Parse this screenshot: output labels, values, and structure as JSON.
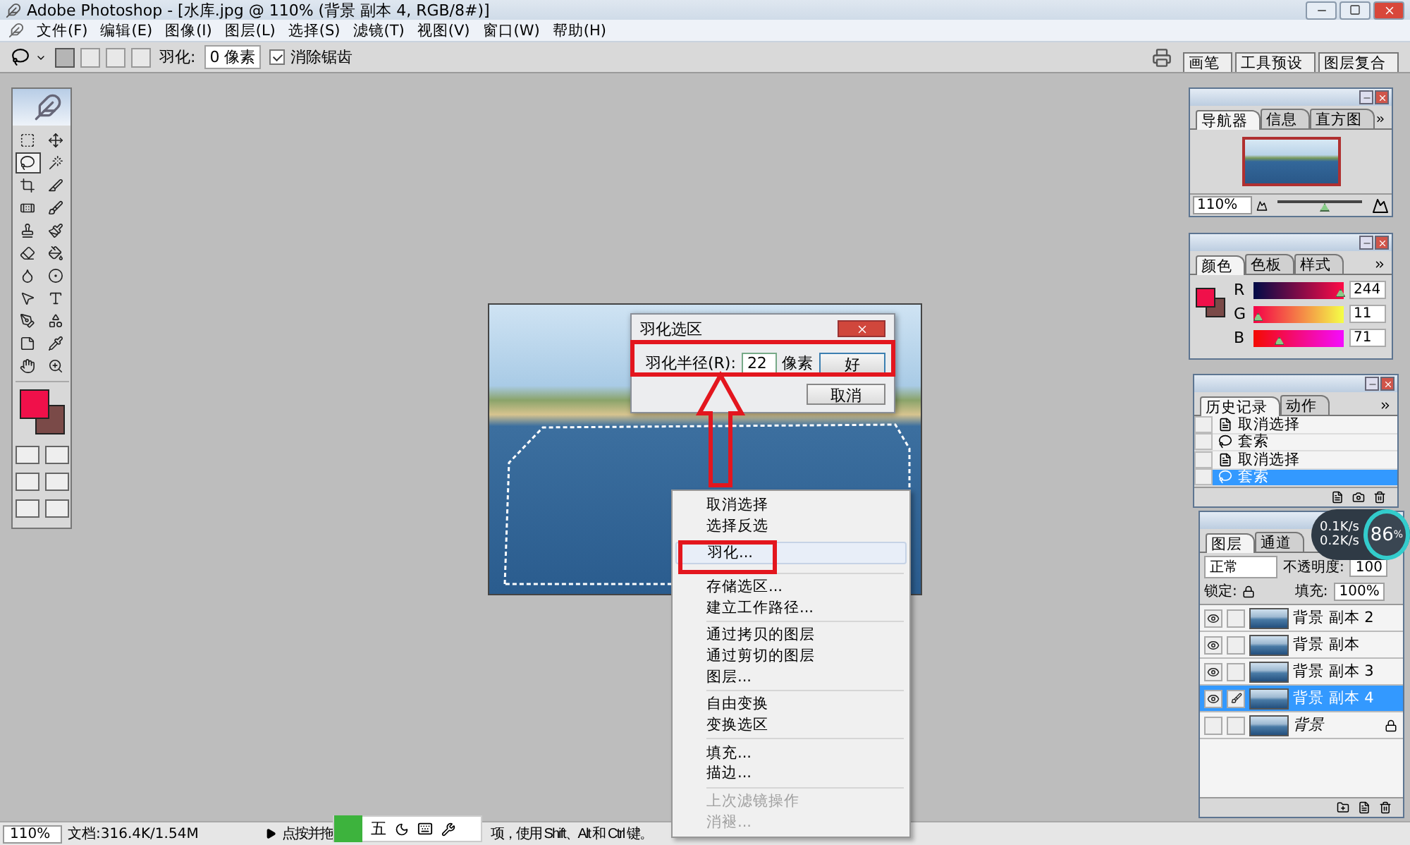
{
  "window": {
    "title": "Adobe Photoshop - [水库.jpg @ 110% (背景 副本 4, RGB/8#)]"
  },
  "menu": [
    "文件(F)",
    "编辑(E)",
    "图像(I)",
    "图层(L)",
    "选择(S)",
    "滤镜(T)",
    "视图(V)",
    "窗口(W)",
    "帮助(H)"
  ],
  "options_bar": {
    "modes": [
      {
        "selected": true
      },
      {
        "selected": false
      },
      {
        "selected": false
      },
      {
        "selected": false
      }
    ],
    "feather_label": "羽化:",
    "feather_value": "0 像素",
    "antialias": {
      "label": "消除锯齿",
      "checked": true
    },
    "palette_well": [
      "画笔",
      "工具预设",
      "图层复合"
    ]
  },
  "toolbox": {
    "tools": [
      {
        "kind": "marquee",
        "selected": false
      },
      {
        "kind": "move",
        "selected": false
      },
      {
        "kind": "lasso",
        "selected": true
      },
      {
        "kind": "wand",
        "selected": false
      },
      {
        "kind": "crop",
        "selected": false
      },
      {
        "kind": "slice",
        "selected": false
      },
      {
        "kind": "healing",
        "selected": false
      },
      {
        "kind": "brush",
        "selected": false
      },
      {
        "kind": "stamp",
        "selected": false
      },
      {
        "kind": "history",
        "selected": false
      },
      {
        "kind": "eraser",
        "selected": false
      },
      {
        "kind": "bucket",
        "selected": false
      },
      {
        "kind": "blur",
        "selected": false
      },
      {
        "kind": "dodge",
        "selected": false
      },
      {
        "kind": "pointer",
        "selected": false
      },
      {
        "kind": "type",
        "selected": false
      },
      {
        "kind": "pen",
        "selected": false
      },
      {
        "kind": "shape",
        "selected": false
      },
      {
        "kind": "notes",
        "selected": false
      },
      {
        "kind": "eyedropper",
        "selected": false
      },
      {
        "kind": "hand",
        "selected": false
      },
      {
        "kind": "zoom",
        "selected": false
      }
    ],
    "swatches": [
      {
        "kind": "foreground",
        "color": "#f0104a"
      },
      {
        "kind": "background",
        "color": "#7a4a48"
      }
    ]
  },
  "navigator": {
    "tabs": [
      {
        "label": "导航器",
        "selected": true
      },
      {
        "label": "信息",
        "selected": false
      },
      {
        "label": "直方图",
        "selected": false
      }
    ],
    "zoom": "110%",
    "slider": {
      "level": 0.55
    }
  },
  "color": {
    "tabs": [
      {
        "label": "颜色",
        "selected": true
      },
      {
        "label": "色板",
        "selected": false
      },
      {
        "label": "样式",
        "selected": false
      }
    ],
    "channels": [
      {
        "name": "R",
        "value": "244",
        "level": 0.957
      },
      {
        "name": "G",
        "value": "11",
        "level": 0.043
      },
      {
        "name": "B",
        "value": "71",
        "level": 0.278
      }
    ]
  },
  "history": {
    "tabs": [
      {
        "label": "历史记录",
        "selected": true
      },
      {
        "label": "动作",
        "selected": false
      }
    ],
    "items": [
      {
        "kind": "deselect",
        "label": "取消选择",
        "selected": false
      },
      {
        "kind": "lasso",
        "label": "套索",
        "selected": false
      },
      {
        "kind": "deselect",
        "label": "取消选择",
        "selected": false
      },
      {
        "kind": "lasso",
        "label": "套索",
        "selected": true
      }
    ]
  },
  "layers": {
    "tabs": [
      {
        "label": "图层",
        "selected": true
      },
      {
        "label": "通道",
        "selected": false
      }
    ],
    "blend_mode": "正常",
    "opacity_label": "不透明度:",
    "opacity": "100",
    "lock_label": "锁定:",
    "fill_label": "填充:",
    "fill": "100%",
    "items": [
      {
        "kind": "copy",
        "name": "背景 副本 2",
        "visible": true,
        "selected": false
      },
      {
        "kind": "copy",
        "name": "背景 副本",
        "visible": true,
        "selected": false
      },
      {
        "kind": "copy",
        "name": "背景 副本 3",
        "visible": true,
        "selected": false
      },
      {
        "kind": "copy",
        "name": "背景 副本 4",
        "visible": true,
        "selected": true
      },
      {
        "kind": "background",
        "name": "背景",
        "visible": false,
        "selected": false
      }
    ]
  },
  "speed_widget": {
    "upload": "0.1K/s",
    "download": "0.2K/s",
    "percent": "86",
    "unit": "%"
  },
  "dialog": {
    "title": "羽化选区",
    "label": "羽化半径(R):",
    "value": "22",
    "unit": "像素",
    "buttons": [
      "好",
      "取消"
    ]
  },
  "context_menu": {
    "groups": [
      [
        {
          "label": "取消选择",
          "selected": false,
          "disabled": false
        },
        {
          "label": "选择反选",
          "selected": false,
          "disabled": false
        },
        {
          "label": "羽化...",
          "selected": true,
          "disabled": false
        }
      ],
      [
        {
          "label": "存储选区...",
          "selected": false,
          "disabled": false
        },
        {
          "label": "建立工作路径...",
          "selected": false,
          "disabled": false
        }
      ],
      [
        {
          "label": "通过拷贝的图层",
          "selected": false,
          "disabled": false
        },
        {
          "label": "通过剪切的图层",
          "selected": false,
          "disabled": false
        },
        {
          "label": "图层...",
          "selected": false,
          "disabled": false
        }
      ],
      [
        {
          "label": "自由变换",
          "selected": false,
          "disabled": false
        },
        {
          "label": "变换选区",
          "selected": false,
          "disabled": false
        }
      ],
      [
        {
          "label": "填充...",
          "selected": false,
          "disabled": false
        },
        {
          "label": "描边...",
          "selected": false,
          "disabled": false
        }
      ],
      [
        {
          "label": "上次滤镜操作",
          "selected": false,
          "disabled": true
        },
        {
          "label": "消褪...",
          "selected": false,
          "disabled": true
        }
      ]
    ]
  },
  "status_bar": {
    "zoom": "110%",
    "document": "文档:316.4K/1.54M",
    "hint_start": "点按并拖",
    "hint_end": "项，使用 Shift、Alt 和 Ctrl 键。"
  },
  "ime_toolbar": {
    "mode": "五"
  }
}
